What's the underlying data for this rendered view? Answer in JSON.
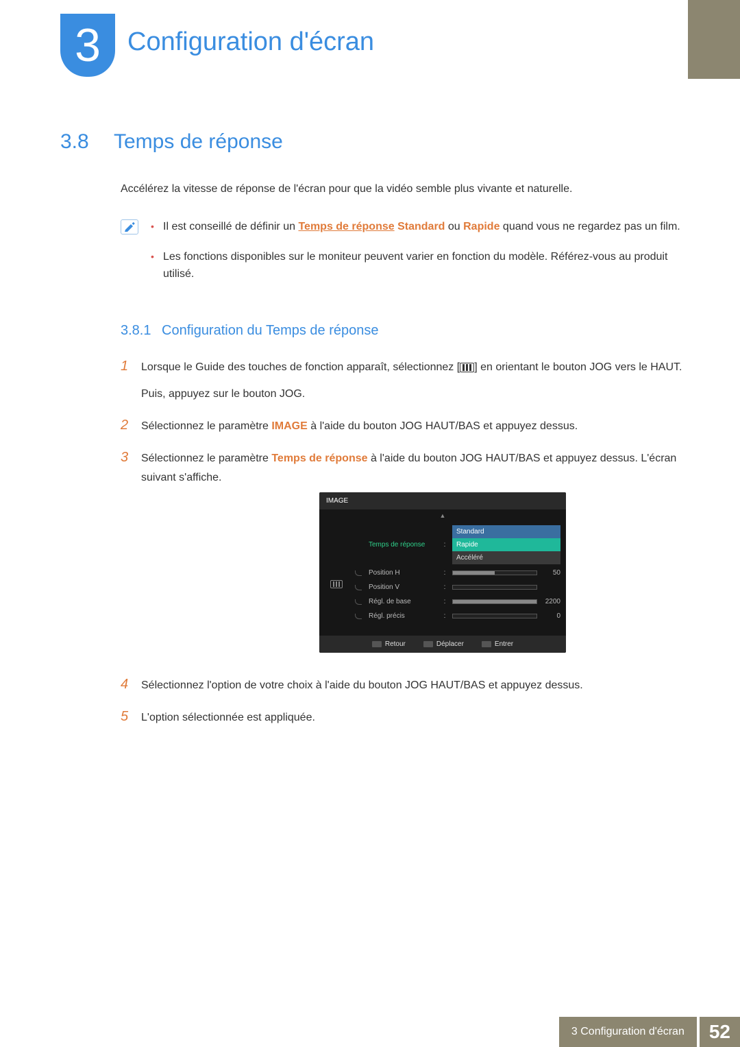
{
  "chapter": {
    "number": "3",
    "title": "Configuration d'écran"
  },
  "section": {
    "number": "3.8",
    "title": "Temps de réponse"
  },
  "intro": "Accélérez la vitesse de réponse de l'écran pour que la vidéo semble plus vivante et naturelle.",
  "notes": {
    "item1_prefix": "Il est conseillé de définir un ",
    "item1_link": "Temps de réponse",
    "item1_mid1": " ",
    "item1_standard": "Standard",
    "item1_mid2": " ou ",
    "item1_rapide": "Rapide",
    "item1_suffix": " quand vous ne regardez pas un film.",
    "item2": "Les fonctions disponibles sur le moniteur peuvent varier en fonction du modèle. Référez-vous au produit utilisé."
  },
  "subsection": {
    "number": "3.8.1",
    "title": "Configuration du Temps de réponse"
  },
  "steps": {
    "s1": {
      "num": "1",
      "pre": "Lorsque le Guide des touches de fonction apparaît, sélectionnez [",
      "post": "] en orientant le bouton JOG vers le HAUT.",
      "sub": "Puis, appuyez sur le bouton JOG."
    },
    "s2": {
      "num": "2",
      "pre": "Sélectionnez le paramètre ",
      "bold": "IMAGE",
      "post": " à l'aide du bouton JOG HAUT/BAS et appuyez dessus."
    },
    "s3": {
      "num": "3",
      "pre": "Sélectionnez le paramètre ",
      "bold": "Temps de réponse",
      "post": " à l'aide du bouton JOG HAUT/BAS et appuyez dessus. L'écran suivant s'affiche."
    },
    "s4": {
      "num": "4",
      "text": "Sélectionnez l'option de votre choix à l'aide du bouton JOG HAUT/BAS et appuyez dessus."
    },
    "s5": {
      "num": "5",
      "text": "L'option sélectionnée est appliquée."
    }
  },
  "osd": {
    "header": "IMAGE",
    "up_arrow": "▲",
    "rows": {
      "r1": {
        "label": "Temps de réponse",
        "options": [
          "Standard",
          "Rapide",
          "Accéléré"
        ]
      },
      "r2": {
        "label": "Position H",
        "value": "50",
        "fill_pct": 50
      },
      "r3": {
        "label": "Position V",
        "value": "",
        "fill_pct": 0
      },
      "r4": {
        "label": "Régl. de base",
        "value": "2200",
        "fill_pct": 100
      },
      "r5": {
        "label": "Régl. précis",
        "value": "0",
        "fill_pct": 0
      }
    },
    "footer": {
      "retour": "Retour",
      "deplacer": "Déplacer",
      "entrer": "Entrer"
    }
  },
  "footer": {
    "label": "3 Configuration d'écran",
    "page": "52"
  }
}
